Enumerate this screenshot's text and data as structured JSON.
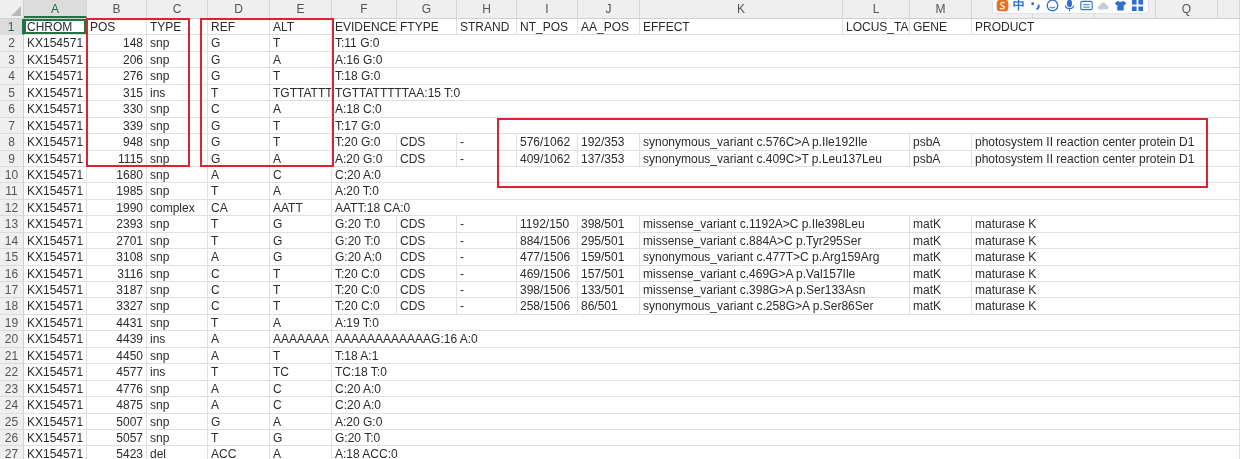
{
  "toolbar": {
    "items": [
      {
        "kind": "logo"
      },
      {
        "kind": "text",
        "label": "中"
      },
      {
        "kind": "punctuation"
      },
      {
        "kind": "emoji"
      },
      {
        "kind": "mic"
      },
      {
        "kind": "keyboard"
      },
      {
        "kind": "cloud"
      },
      {
        "kind": "shirt"
      },
      {
        "kind": "apps"
      }
    ]
  },
  "columns": [
    {
      "label": "A",
      "selected": true
    },
    {
      "label": "B",
      "selected": false
    },
    {
      "label": "C",
      "selected": false
    },
    {
      "label": "D",
      "selected": false
    },
    {
      "label": "E",
      "selected": false
    },
    {
      "label": "F",
      "selected": false
    },
    {
      "label": "G",
      "selected": false
    },
    {
      "label": "H",
      "selected": false
    },
    {
      "label": "I",
      "selected": false
    },
    {
      "label": "J",
      "selected": false
    },
    {
      "label": "K",
      "selected": false
    },
    {
      "label": "L",
      "selected": false
    },
    {
      "label": "M",
      "selected": false
    },
    {
      "selected": false
    },
    {
      "selected": false
    },
    {
      "selected": false
    },
    {
      "label": "Q",
      "selected": false
    },
    {
      "selected": false
    }
  ],
  "rows": [
    {
      "number": "1",
      "kind": "header",
      "selected": true,
      "cells": [
        "CHROM",
        "POS",
        "TYPE",
        "REF",
        "ALT",
        "EVIDENCE",
        "FTYPE",
        "STRAND",
        "NT_POS",
        "AA_POS",
        "EFFECT",
        "LOCUS_TA",
        "GENE",
        "PRODUCT"
      ]
    },
    {
      "number": "2",
      "kind": "data",
      "selected": false,
      "cells": [
        "KX154571",
        "148",
        "snp",
        "G",
        "T",
        "T:11 G:0"
      ]
    },
    {
      "number": "3",
      "kind": "data",
      "selected": false,
      "cells": [
        "KX154571",
        "206",
        "snp",
        "G",
        "A",
        "A:16 G:0"
      ]
    },
    {
      "number": "4",
      "kind": "data",
      "selected": false,
      "cells": [
        "KX154571",
        "276",
        "snp",
        "G",
        "T",
        "T:18 G:0"
      ]
    },
    {
      "number": "5",
      "kind": "data",
      "selected": false,
      "cells": [
        "KX154571",
        "315",
        "ins",
        "T",
        "TGTTATTT",
        "TGTTATTTTTAA:15 T:0"
      ]
    },
    {
      "number": "6",
      "kind": "data",
      "selected": false,
      "cells": [
        "KX154571",
        "330",
        "snp",
        "C",
        "A",
        "A:18 C:0"
      ]
    },
    {
      "number": "7",
      "kind": "data",
      "selected": false,
      "cells": [
        "KX154571",
        "339",
        "snp",
        "G",
        "T",
        "T:17 G:0"
      ]
    },
    {
      "number": "8",
      "kind": "data",
      "selected": false,
      "cells": [
        "KX154571",
        "948",
        "snp",
        "G",
        "T",
        "T:20 G:0",
        "CDS",
        "-",
        "576/1062",
        "192/353",
        "synonymous_variant c.576C>A p.Ile192Ile",
        null,
        "psbA",
        "photosystem II reaction center protein D1"
      ]
    },
    {
      "number": "9",
      "kind": "data",
      "selected": false,
      "cells": [
        "KX154571",
        "1115",
        "snp",
        "G",
        "A",
        "A:20 G:0",
        "CDS",
        "-",
        "409/1062",
        "137/353",
        "synonymous_variant c.409C>T p.Leu137Leu",
        null,
        "psbA",
        "photosystem II reaction center protein D1"
      ]
    },
    {
      "number": "10",
      "kind": "data",
      "selected": false,
      "cells": [
        "KX154571",
        "1680",
        "snp",
        "A",
        "C",
        "C:20 A:0"
      ]
    },
    {
      "number": "11",
      "kind": "data",
      "selected": false,
      "cells": [
        "KX154571",
        "1985",
        "snp",
        "T",
        "A",
        "A:20 T:0"
      ]
    },
    {
      "number": "12",
      "kind": "data",
      "selected": false,
      "cells": [
        "KX154571",
        "1990",
        "complex",
        "CA",
        "AATT",
        "AATT:18 CA:0"
      ]
    },
    {
      "number": "13",
      "kind": "data",
      "selected": false,
      "cells": [
        "KX154571",
        "2393",
        "snp",
        "T",
        "G",
        "G:20 T:0",
        "CDS",
        "-",
        "1192/150",
        "398/501",
        "missense_variant c.1192A>C p.Ile398Leu",
        null,
        "matK",
        "maturase K"
      ]
    },
    {
      "number": "14",
      "kind": "data",
      "selected": false,
      "cells": [
        "KX154571",
        "2701",
        "snp",
        "T",
        "G",
        "G:20 T:0",
        "CDS",
        "-",
        "884/1506",
        "295/501",
        "missense_variant c.884A>C p.Tyr295Ser",
        null,
        "matK",
        "maturase K"
      ]
    },
    {
      "number": "15",
      "kind": "data",
      "selected": false,
      "cells": [
        "KX154571",
        "3108",
        "snp",
        "A",
        "G",
        "G:20 A:0",
        "CDS",
        "-",
        "477/1506",
        "159/501",
        "synonymous_variant c.477T>C p.Arg159Arg",
        null,
        "matK",
        "maturase K"
      ]
    },
    {
      "number": "16",
      "kind": "data",
      "selected": false,
      "cells": [
        "KX154571",
        "3116",
        "snp",
        "C",
        "T",
        "T:20 C:0",
        "CDS",
        "-",
        "469/1506",
        "157/501",
        "missense_variant c.469G>A p.Val157Ile",
        null,
        "matK",
        "maturase K"
      ]
    },
    {
      "number": "17",
      "kind": "data",
      "selected": false,
      "cells": [
        "KX154571",
        "3187",
        "snp",
        "C",
        "T",
        "T:20 C:0",
        "CDS",
        "-",
        "398/1506",
        "133/501",
        "missense_variant c.398G>A p.Ser133Asn",
        null,
        "matK",
        "maturase K"
      ]
    },
    {
      "number": "18",
      "kind": "data",
      "selected": false,
      "cells": [
        "KX154571",
        "3327",
        "snp",
        "C",
        "T",
        "T:20 C:0",
        "CDS",
        "-",
        "258/1506",
        "86/501",
        "synonymous_variant c.258G>A p.Ser86Ser",
        null,
        "matK",
        "maturase K"
      ]
    },
    {
      "number": "19",
      "kind": "data",
      "selected": false,
      "cells": [
        "KX154571",
        "4431",
        "snp",
        "T",
        "A",
        "A:19 T:0"
      ]
    },
    {
      "number": "20",
      "kind": "data",
      "selected": false,
      "cells": [
        "KX154571",
        "4439",
        "ins",
        "A",
        "AAAAAAA",
        "AAAAAAAAAAAAG:16 A:0"
      ]
    },
    {
      "number": "21",
      "kind": "data",
      "selected": false,
      "cells": [
        "KX154571",
        "4450",
        "snp",
        "A",
        "T",
        "T:18 A:1"
      ]
    },
    {
      "number": "22",
      "kind": "data",
      "selected": false,
      "cells": [
        "KX154571",
        "4577",
        "ins",
        "T",
        "TC",
        "TC:18 T:0"
      ]
    },
    {
      "number": "23",
      "kind": "data",
      "selected": false,
      "cells": [
        "KX154571",
        "4776",
        "snp",
        "A",
        "C",
        "C:20 A:0"
      ]
    },
    {
      "number": "24",
      "kind": "data",
      "selected": false,
      "cells": [
        "KX154571",
        "4875",
        "snp",
        "A",
        "C",
        "C:20 A:0"
      ]
    },
    {
      "number": "25",
      "kind": "data",
      "selected": false,
      "cells": [
        "KX154571",
        "5007",
        "snp",
        "G",
        "A",
        "A:20 G:0"
      ]
    },
    {
      "number": "26",
      "kind": "data",
      "selected": false,
      "cells": [
        "KX154571",
        "5057",
        "snp",
        "T",
        "G",
        "G:20 T:0"
      ]
    },
    {
      "number": "27",
      "kind": "data",
      "selected": false,
      "cells": [
        "KX154571",
        "5423",
        "del",
        "ACC",
        "A",
        "A:18 ACC:0"
      ]
    }
  ],
  "annotations": [
    {
      "kind": "box"
    },
    {
      "kind": "box"
    },
    {
      "kind": "box"
    }
  ]
}
